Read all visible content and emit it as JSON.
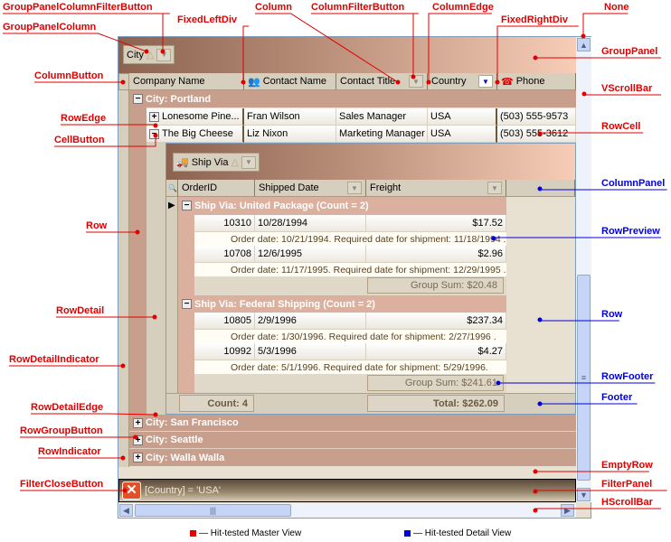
{
  "master": {
    "group_panel_column": "City",
    "columns": [
      "Company Name",
      "Contact Name",
      "Contact Title",
      "Country",
      "Phone"
    ],
    "group_rows": [
      "City: Portland",
      "City: San Francisco",
      "City: Seattle",
      "City: Walla Walla"
    ],
    "rows": [
      {
        "company": "Lonesome  Pine...",
        "contact": "Fran Wilson",
        "title": "Sales Manager",
        "country": "USA",
        "phone": "(503) 555-9573"
      },
      {
        "company": "The Big Cheese",
        "contact": "Liz Nixon",
        "title": "Marketing Manager",
        "country": "USA",
        "phone": "(503) 555-3612"
      }
    ],
    "filter_text": "[Country] = 'USA'"
  },
  "detail": {
    "group_panel_column": "Ship Via",
    "columns": [
      "OrderID",
      "Shipped Date",
      "Freight"
    ],
    "groups": [
      {
        "title": "Ship Via: United Package (Count = 2)",
        "rows": [
          {
            "id": "10310",
            "date": "10/28/1994",
            "freight": "$17.52",
            "preview": "Order date: 10/21/1994. Required date for shipment: 11/18/1994 ."
          },
          {
            "id": "10708",
            "date": "12/6/1995",
            "freight": "$2.96",
            "preview": "Order date: 11/17/1995. Required date for shipment: 12/29/1995 ."
          }
        ],
        "sum": "Group Sum: $20.48"
      },
      {
        "title": "Ship Via: Federal Shipping (Count = 2)",
        "rows": [
          {
            "id": "10805",
            "date": "2/9/1996",
            "freight": "$237.34",
            "preview": "Order date: 1/30/1996. Required date for shipment: 2/27/1996 ."
          },
          {
            "id": "10992",
            "date": "5/3/1996",
            "freight": "$4.27",
            "preview": "Order date: 5/1/1996. Required date for shipment: 5/29/1996."
          }
        ],
        "sum": "Group Sum: $241.61"
      }
    ],
    "footer_count": "Count: 4",
    "footer_total": "Total: $262.09"
  },
  "labels": {
    "left": [
      "GroupPanelColumnFilterButton",
      "GroupPanelColumn",
      "ColumnButton",
      "RowEdge",
      "CellButton",
      "Row",
      "RowDetail",
      "RowDetailIndicator",
      "RowDetailEdge",
      "RowGroupButton",
      "RowIndicator",
      "FilterCloseButton"
    ],
    "top": [
      "FixedLeftDiv",
      "Column",
      "ColumnFilterButton",
      "ColumnEdge",
      "FixedRightDiv",
      "None"
    ],
    "right": [
      "GroupPanel",
      "VScrollBar",
      "RowCell",
      "ColumnPanel",
      "RowPreview",
      "Row",
      "RowFooter",
      "Footer",
      "EmptyRow",
      "FilterPanel",
      "HScrollBar"
    ]
  },
  "legend": {
    "master": "— Hit-tested Master View",
    "detail": "— Hit-tested Detail View"
  },
  "colors": {
    "master": "#e00000",
    "detail": "#0000e0"
  }
}
